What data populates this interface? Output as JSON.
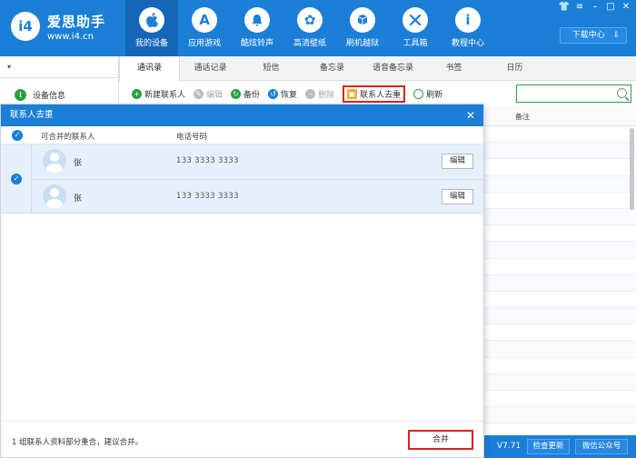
{
  "app": {
    "brand_name": "爱思助手",
    "brand_url": "www.i4.cn",
    "logo_text": "i4"
  },
  "nav": [
    {
      "label": "我的设备",
      "icon": "apple-icon",
      "glyph": "",
      "active": true
    },
    {
      "label": "应用游戏",
      "icon": "appstore-icon",
      "glyph": "A"
    },
    {
      "label": "酷炫铃声",
      "icon": "bell-icon",
      "glyph": "♪"
    },
    {
      "label": "高清壁纸",
      "icon": "flower-icon",
      "glyph": "✿"
    },
    {
      "label": "刷机越狱",
      "icon": "box-icon",
      "glyph": "❒"
    },
    {
      "label": "工具箱",
      "icon": "tools-icon",
      "glyph": "✕"
    },
    {
      "label": "教程中心",
      "icon": "info-icon",
      "glyph": "i"
    }
  ],
  "download_center": "下载中心",
  "sidebar": {
    "items": [
      {
        "label": "设备信息",
        "icon": "info-icon"
      }
    ]
  },
  "tabs": [
    "通讯录",
    "通话记录",
    "短信",
    "备忘录",
    "语音备忘录",
    "书签",
    "日历"
  ],
  "toolbar": {
    "new_contact": "新建联系人",
    "edit": "编辑",
    "backup": "备份",
    "restore": "恢复",
    "delete": "删除",
    "dedupe": "联系人去重",
    "refresh": "刷新"
  },
  "table": {
    "note_header": "备注"
  },
  "status": {
    "version": "V7.71",
    "check_update": "检查更新",
    "wechat": "微信公众号"
  },
  "dialog": {
    "title": "联系人去重",
    "col_contacts": "可合并的联系人",
    "col_phone": "电话号码",
    "contacts": [
      {
        "name": "张",
        "phone": "133 3333 3333",
        "edit": "编辑"
      },
      {
        "name": "张",
        "phone": "133 3333 3333",
        "edit": "编辑"
      }
    ],
    "footer_message": "1 组联系人资料部分重合，建议合并。",
    "merge": "合并"
  },
  "colors": {
    "primary": "#1b7fd8",
    "highlight": "#e02020",
    "success": "#27a13b"
  }
}
